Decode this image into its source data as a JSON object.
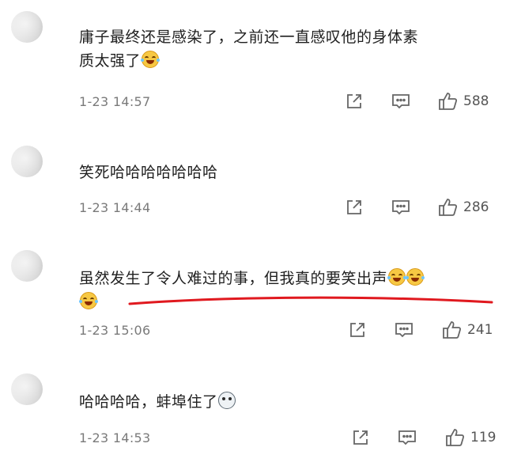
{
  "comments": [
    {
      "line1": "庸子最终还是感染了，之前还一直感叹他的身体素",
      "line2": "质太强了",
      "timestamp": "1-23 14:57",
      "likes": "588"
    },
    {
      "line1": "笑死哈哈哈哈哈哈哈",
      "timestamp": "1-23 14:44",
      "likes": "286"
    },
    {
      "line1": "虽然发生了令人难过的事，但我真的要笑出声",
      "timestamp": "1-23 15:06",
      "likes": "241"
    },
    {
      "line1": "哈哈哈哈，蚌埠住了",
      "timestamp": "1-23 14:53",
      "likes": "119"
    }
  ],
  "icons": {
    "share": "share-icon",
    "reply": "comment-icon",
    "like": "thumbs-up-icon",
    "laugh_emoji": "laugh-cry-emoji",
    "dog_emoji": "dog-emoji"
  },
  "colors": {
    "underline": "#e0191f",
    "timestamp": "#7a7a7a",
    "text": "#1f1f1f",
    "icon": "#666666"
  }
}
